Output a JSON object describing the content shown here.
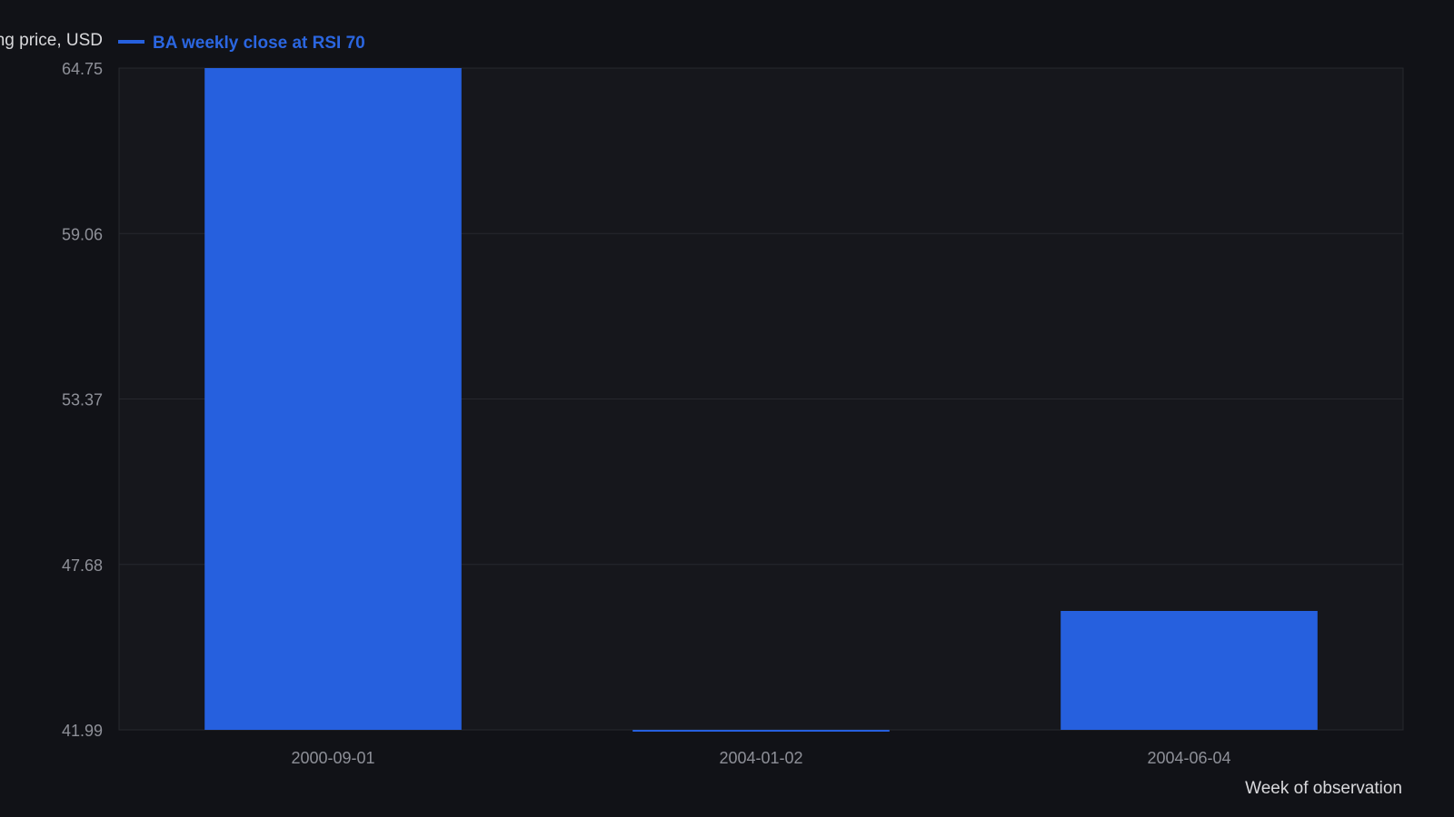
{
  "chart_data": {
    "type": "bar",
    "ylabel": "Closing price, USD",
    "xlabel": "Week of observation",
    "legend": {
      "placement": "top-left",
      "entries": [
        {
          "label": "BA weekly close at RSI 70"
        }
      ]
    },
    "categories": [
      "2000-09-01",
      "2004-01-02",
      "2004-06-04"
    ],
    "series": [
      {
        "name": "BA weekly close at RSI 70",
        "values": [
          64.75,
          41.91,
          46.08
        ]
      }
    ],
    "ylim": [
      41.99,
      64.75
    ],
    "yticks": [
      "41.99",
      "47.68",
      "53.37",
      "59.06",
      "64.75"
    ],
    "grid": true
  },
  "colors": {
    "background": "#111217",
    "plot_background": "#16171c",
    "bar": "#2660de",
    "grid": "#26282e",
    "axis_text": "#8e9098",
    "label_text": "#d9d9dc",
    "legend_text": "#2b66e0"
  }
}
